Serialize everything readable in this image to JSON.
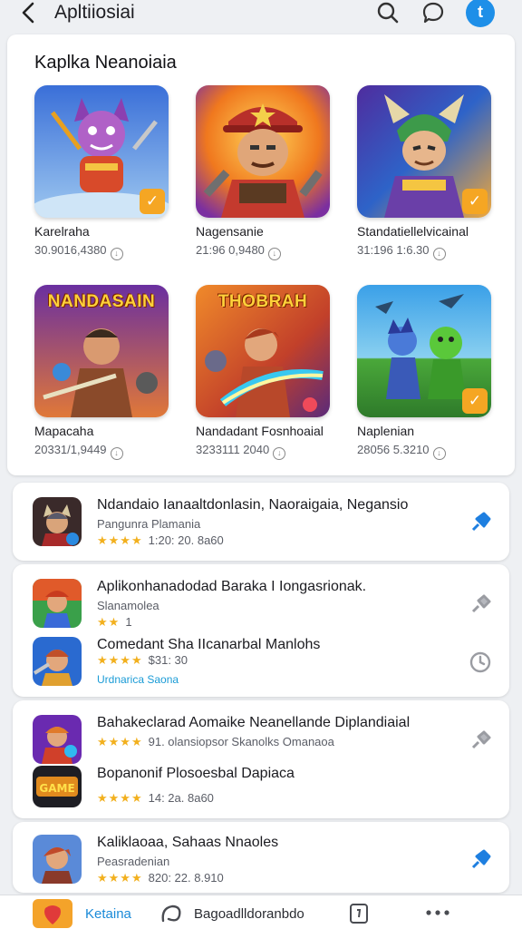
{
  "header": {
    "title": "Apltiiosiai",
    "back_icon": "chevron-left-icon",
    "search_icon": "search-icon",
    "chat_icon": "chat-bubble-icon",
    "profile_letter": "t"
  },
  "featured": {
    "title": "Kaplka Neanoiaia",
    "items": [
      {
        "name": "Karelraha",
        "meta": "30.9016,4380"
      },
      {
        "name": "Nagensanie",
        "meta": "21:96 0,9480"
      },
      {
        "name": "Standatiellelvicainal",
        "meta": "31:196 1:6.30"
      },
      {
        "name": "Mapacaha",
        "meta": "20331/1,9449",
        "banner": "NANDASAIN"
      },
      {
        "name": "Nandadant Fosnhoaial",
        "meta": "3233111 2040",
        "banner": "THOBRAH"
      },
      {
        "name": "Naplenian",
        "meta": "28056 5.3210"
      }
    ]
  },
  "list": [
    {
      "title": "Ndandaio Ianaaltdonlasin, Naoraigaia, Negansio",
      "sub": "Pangunra Plamania",
      "stars": "★★★★",
      "rating": "1:20: 20. 8a60"
    },
    {
      "title": "Aplikonhanadodad Baraka I Iongasrionak.",
      "sub": "Slanamolea",
      "stars": "★★",
      "rating": "1"
    },
    {
      "title": "Comedant Sha IIcanarbal Manlohs",
      "stars": "★★★★",
      "rating": "$31: 30",
      "link": "Urdnarica Saona"
    },
    {
      "title": "Bahakeclarad Aomaike Neanellande Diplandiaial",
      "stars": "★★★★",
      "rating": "91. olansiopsor Skanolks  Omanaoa"
    },
    {
      "title": "Bopanonif Plosoesbal Dapiaca",
      "stars": "★★★★",
      "rating": "14: 2a. 8a60"
    },
    {
      "title": "Kaliklaoaa, Sahaas Nnaoles",
      "sub": "Peasradenian",
      "stars": "★★★★",
      "rating": "820: 22. 8.910"
    }
  ],
  "bottom_nav": {
    "tab1": "Ketaina",
    "tab2": "Bagoadlldoranbdo"
  }
}
